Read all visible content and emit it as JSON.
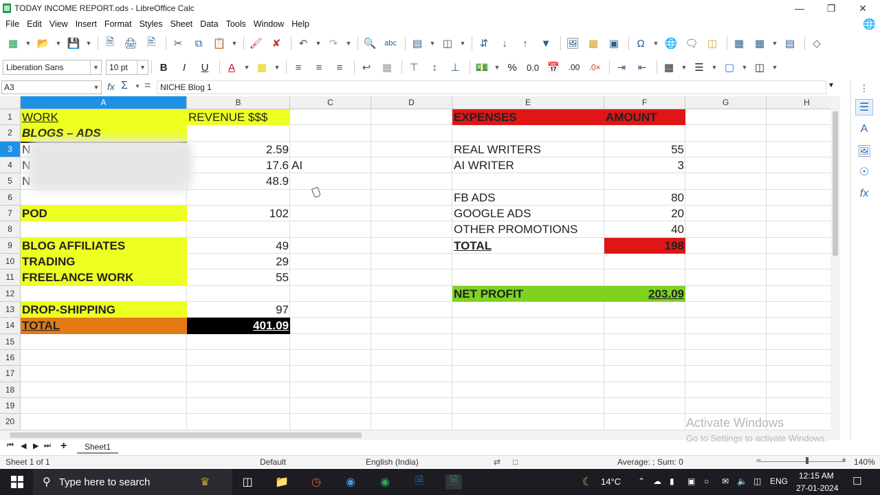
{
  "window": {
    "title": "TODAY INCOME REPORT.ods - LibreOffice Calc"
  },
  "menu": [
    "File",
    "Edit",
    "View",
    "Insert",
    "Format",
    "Styles",
    "Sheet",
    "Data",
    "Tools",
    "Window",
    "Help"
  ],
  "format_toolbar": {
    "font_name": "Liberation Sans",
    "font_size": "10 pt"
  },
  "formula_bar": {
    "cell_ref": "A3",
    "content": "NICHE Blog 1"
  },
  "columns": [
    "A",
    "B",
    "C",
    "D",
    "E",
    "F",
    "G",
    "H"
  ],
  "rows": [
    "1",
    "2",
    "3",
    "4",
    "5",
    "6",
    "7",
    "8",
    "9",
    "10",
    "11",
    "12",
    "13",
    "14",
    "15",
    "16",
    "17",
    "18",
    "19",
    "20"
  ],
  "cells": {
    "a1": "WORK",
    "b1": "REVENUE $$$",
    "a2": "BLOGS – ADS",
    "a3": "N",
    "b3": "2.59",
    "a4": "N",
    "b4": "17.6",
    "c4": "AI",
    "a5": "N",
    "b5": "48.9",
    "a7": "POD",
    "b7": "102",
    "a9": "BLOG AFFILIATES",
    "b9": "49",
    "a10": "TRADING",
    "b10": "29",
    "a11": "FREELANCE WORK",
    "b11": "55",
    "a13": "DROP-SHIPPING",
    "b13": "97",
    "a14": "TOTAL",
    "b14": "401.09",
    "e1": "EXPENSES",
    "f1": "AMOUNT",
    "e3": "REAL WRITERS",
    "f3": "55",
    "e4": "AI WRITER",
    "f4": "3",
    "e6": "FB ADS",
    "f6": "80",
    "e7": "GOOGLE ADS",
    "f7": "20",
    "e8": "OTHER PROMOTIONS",
    "f8": "40",
    "e9": "TOTAL",
    "f9": "198",
    "e12": "NET PROFIT",
    "f12": "203.09"
  },
  "colors": {
    "yellow": "#eeff22",
    "red": "#e01515",
    "orange": "#e27a16",
    "green": "#7ed321",
    "black": "#000000",
    "selection": "#1e90e6"
  },
  "sheet_tabs": {
    "active": "Sheet1"
  },
  "watermark": {
    "line1": "Activate Windows",
    "line2": "Go to Settings to activate Windows."
  },
  "status": {
    "sheet": "Sheet 1 of 1",
    "style": "Default",
    "language": "English (India)",
    "summary": "Average: ; Sum: 0",
    "zoom": "140%"
  },
  "taskbar": {
    "search_placeholder": "Type here to search",
    "weather": "14°C",
    "lang": "ENG",
    "time": "12:15 AM",
    "date": "27-01-2024"
  }
}
